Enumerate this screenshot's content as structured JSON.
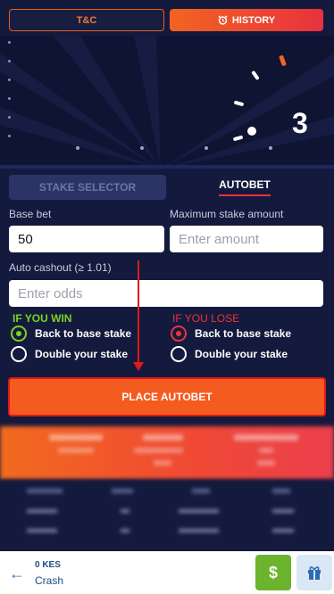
{
  "top_tabs": {
    "tc_label": "T&C",
    "history_label": "HISTORY"
  },
  "game": {
    "counter": "3"
  },
  "panel_tabs": {
    "stake_selector": "STAKE SELECTOR",
    "autobet": "AUTOBET"
  },
  "form": {
    "base_bet_label": "Base bet",
    "base_bet_value": "50",
    "max_stake_label": "Maximum stake amount",
    "max_stake_placeholder": "Enter amount",
    "auto_cashout_label": "Auto cashout (≥ 1.01)",
    "auto_cashout_placeholder": "Enter odds"
  },
  "win": {
    "title": "IF YOU WIN",
    "color": "#7bd321",
    "options": [
      "Back to base stake",
      "Double your stake"
    ],
    "selected": 0
  },
  "lose": {
    "title": "IF YOU LOSE",
    "color": "#e9343b",
    "options": [
      "Back to base stake",
      "Double your stake"
    ],
    "selected": 0
  },
  "place_button": "PLACE AUTOBET",
  "bottom_bar": {
    "balance": "0 KES",
    "game_name": "Crash",
    "deposit_symbol": "$"
  },
  "colors": {
    "accent_orange": "#f45b1e",
    "accent_red": "#e01919",
    "background": "#141a3d"
  }
}
